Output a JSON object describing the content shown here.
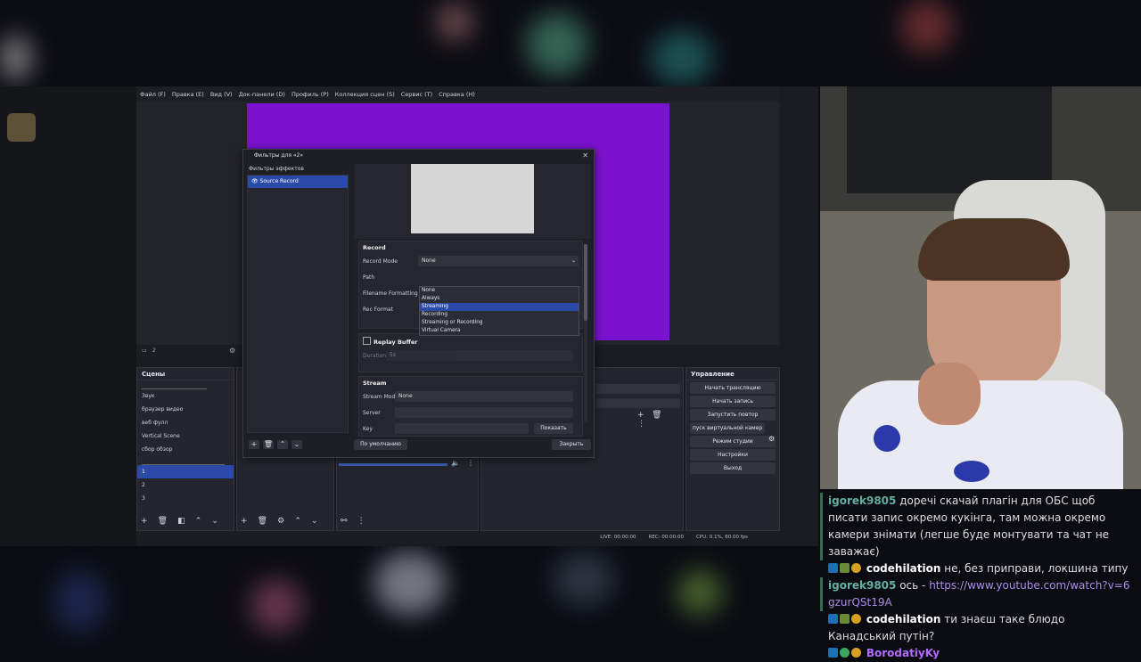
{
  "obs": {
    "menu": [
      "Файл (F)",
      "Правка (E)",
      "Вид (V)",
      "Док-панели (D)",
      "Профиль (P)",
      "Коллекция сцен (S)",
      "Сервис (T)",
      "Справка (H)"
    ],
    "source_count": "2",
    "scenes_title": "Сцены",
    "scenes": [
      "Звук",
      "браузер видео",
      "веб фулл",
      "Vertical Scene",
      "сбор обзор"
    ],
    "scenes_numbered": [
      "1",
      "2",
      "3"
    ],
    "controls_title": "Управление",
    "controls": [
      "Начать трансляцию",
      "Начать запись",
      "Запустить повтор",
      "пуск виртуальной камер",
      "Режим студии",
      "Настройки",
      "Выход"
    ],
    "status": {
      "live": "LIVE: 00:00:00",
      "rec": "REC: 00:00:00",
      "cpu": "CPU: 0.1%, 60.00 fps"
    }
  },
  "dialog": {
    "title": "Фильтры для «2»",
    "left_label": "Фильтры эффектов",
    "filter_name": "Source Record",
    "record_section": "Record",
    "labels": {
      "record_mode": "Record Mode",
      "path": "Path",
      "filename": "Filename Formatting",
      "rec_format": "Rec Format"
    },
    "record_mode_value": "None",
    "dropdown_options": [
      "None",
      "Always",
      "Streaming",
      "Recording",
      "Streaming or Recording",
      "Virtual Camera"
    ],
    "highlighted_option_index": 2,
    "replay_buffer_label": "Replay Buffer",
    "duration_label": "Duration",
    "duration_value": "5s",
    "stream_section": "Stream",
    "stream_labels": {
      "mode": "Stream Mode",
      "server": "Server",
      "key": "Key"
    },
    "stream_mode_value": "None",
    "show_button": "Показать",
    "defaults_button": "По умолчанию",
    "close_button": "Закрыть"
  },
  "chat": [
    {
      "user": "igorek9805",
      "color": "#5fb0a0",
      "text": "доречі скачай плагін для ОБС щоб писати запис окремо кукінга, там можна окремо камери знімати (легше буде монтувати та чат не заважає)",
      "highlight": true
    },
    {
      "user": "codehilation",
      "color": "#ffffff",
      "text": "не, без приправи, локшина типу",
      "badges": true
    },
    {
      "user": "igorek9805",
      "color": "#5fb0a0",
      "text": "ось - ",
      "link": "https://www.youtube.com/watch?v=6gzurQSt19A",
      "highlight": true
    },
    {
      "user": "codehilation",
      "color": "#ffffff",
      "text": "ти знаєш таке блюдо Канадський путін?",
      "badges": true
    },
    {
      "user": "BorodatiyKy",
      "color": "#b36bff",
      "text": "",
      "badges": true
    }
  ],
  "colors": {
    "accent_blue": "#2b4aa8",
    "purple_source": "#7b12d0",
    "chat_highlight": "#3a6a52"
  }
}
